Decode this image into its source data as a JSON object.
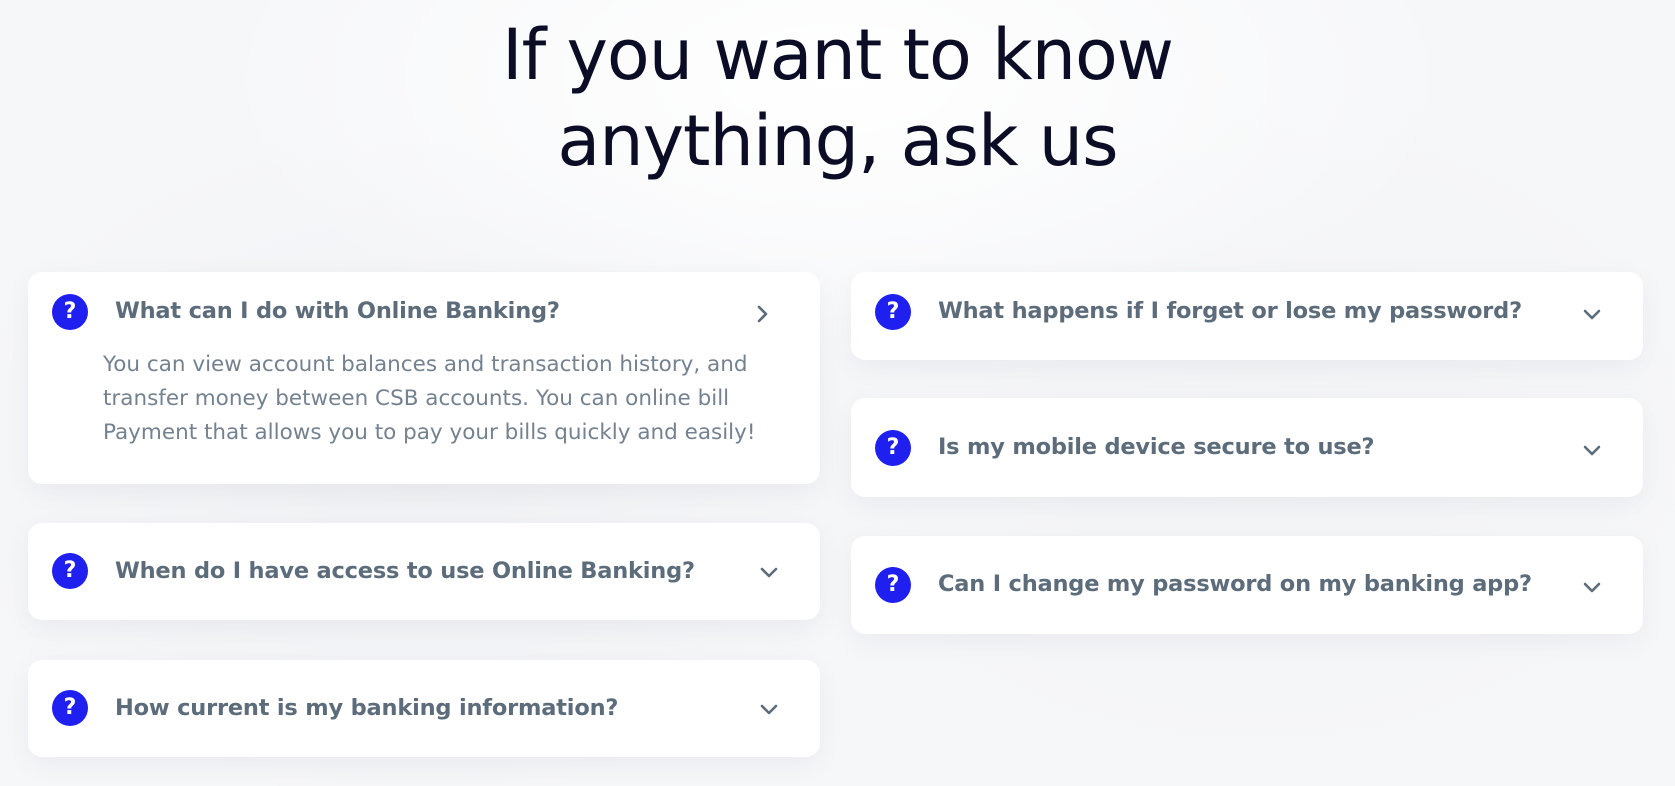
{
  "heading": {
    "line1": "If you want to know",
    "line2": "anything, ask us"
  },
  "colors": {
    "accent": "#1f1ff0",
    "question_text": "#5d6c7b",
    "answer_text": "#748290",
    "heading_text": "#0b0d26",
    "card_bg": "#ffffff"
  },
  "faq": {
    "left": [
      {
        "question": "What can I do with Online Banking?",
        "expanded": true,
        "toggle_icon": "chevron-right-icon",
        "answer": "You can view account balances and transaction history, and transfer money between CSB accounts. You can online bill Payment that allows you to pay your bills quickly and easily!"
      },
      {
        "question": "When do I have access to use Online Banking?",
        "expanded": false,
        "toggle_icon": "chevron-down-icon"
      },
      {
        "question": "How current is my banking information?",
        "expanded": false,
        "toggle_icon": "chevron-down-icon"
      }
    ],
    "right": [
      {
        "question": "What happens if I forget or lose my password?",
        "expanded": false,
        "toggle_icon": "chevron-down-icon"
      },
      {
        "question": "Is my mobile device secure to use?",
        "expanded": false,
        "toggle_icon": "chevron-down-icon"
      },
      {
        "question": "Can I change my password on my banking app?",
        "expanded": false,
        "toggle_icon": "chevron-down-icon"
      }
    ],
    "icon_glyph": "?"
  }
}
